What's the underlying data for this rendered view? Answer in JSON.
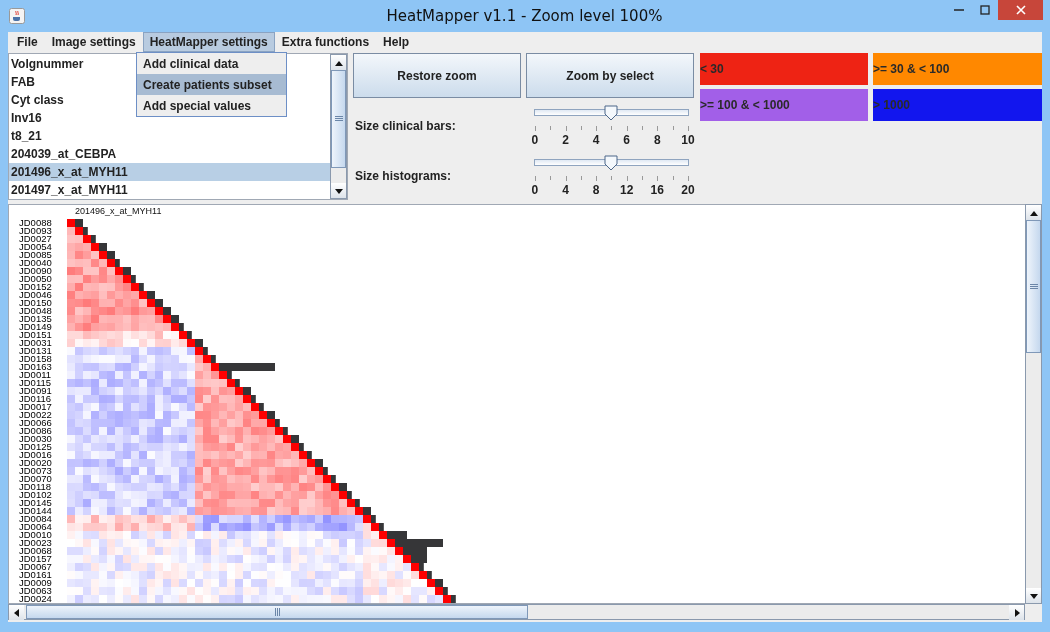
{
  "window": {
    "title": "HeatMapper v1.1 - Zoom level 100%"
  },
  "menu": [
    {
      "label": "File",
      "selected": false
    },
    {
      "label": "Image settings",
      "selected": false
    },
    {
      "label": "HeatMapper settings",
      "selected": true
    },
    {
      "label": "Extra functions",
      "selected": false
    },
    {
      "label": "Help",
      "selected": false
    }
  ],
  "open_menu": {
    "items": [
      {
        "label": "Add clinical data",
        "selected": false
      },
      {
        "label": "Create patients subset",
        "selected": true
      },
      {
        "label": "Add special values",
        "selected": false
      }
    ]
  },
  "variables": {
    "items": [
      {
        "label": "Volgnummer",
        "selected": false
      },
      {
        "label": "FAB",
        "selected": false
      },
      {
        "label": "Cyt class",
        "selected": false
      },
      {
        "label": "Inv16",
        "selected": false
      },
      {
        "label": "t8_21",
        "selected": false
      },
      {
        "label": "204039_at_CEBPA",
        "selected": false
      },
      {
        "label": "201496_x_at_MYH11",
        "selected": true
      },
      {
        "label": "201497_x_at_MYH11",
        "selected": false
      }
    ]
  },
  "buttons": [
    "Restore zoom",
    "Zoom by select"
  ],
  "sliders": [
    {
      "label": "Size clinical bars:",
      "level": 0.5,
      "ticks": [
        "0",
        "2",
        "4",
        "6",
        "8",
        "10"
      ]
    },
    {
      "label": "Size histograms:",
      "level": 0.5,
      "ticks": [
        "0",
        "4",
        "8",
        "12",
        "16",
        "20"
      ]
    }
  ],
  "legend": [
    {
      "label": "< 30",
      "color": "#ee2314"
    },
    {
      "label": ">= 30 & < 100",
      "color": "#ff8800"
    },
    {
      "label": ">= 100 & < 1000",
      "color": "#a25fe8"
    },
    {
      "label": "> 1000",
      "color": "#1216ee"
    }
  ],
  "heatmap": {
    "title": "201496_x_at_MYH11",
    "rows": [
      "JD0088",
      "JD0093",
      "JD0027",
      "JD0054",
      "JD0085",
      "JD0040",
      "JD0090",
      "JD0050",
      "JD0152",
      "JD0046",
      "JD0150",
      "JD0048",
      "JD0135",
      "JD0149",
      "JD0151",
      "JD0031",
      "JD0131",
      "JD0158",
      "JD0163",
      "JD0011",
      "JD0115",
      "JD0091",
      "JD0116",
      "JD0017",
      "JD0022",
      "JD0066",
      "JD0086",
      "JD0030",
      "JD0125",
      "JD0016",
      "JD0020",
      "JD0073",
      "JD0070",
      "JD0118",
      "JD0102",
      "JD0145",
      "JD0144",
      "JD0084",
      "JD0064",
      "JD0010",
      "JD0023",
      "JD0068",
      "JD0157",
      "JD0067",
      "JD0161",
      "JD0009",
      "JD0063",
      "JD0024"
    ]
  }
}
